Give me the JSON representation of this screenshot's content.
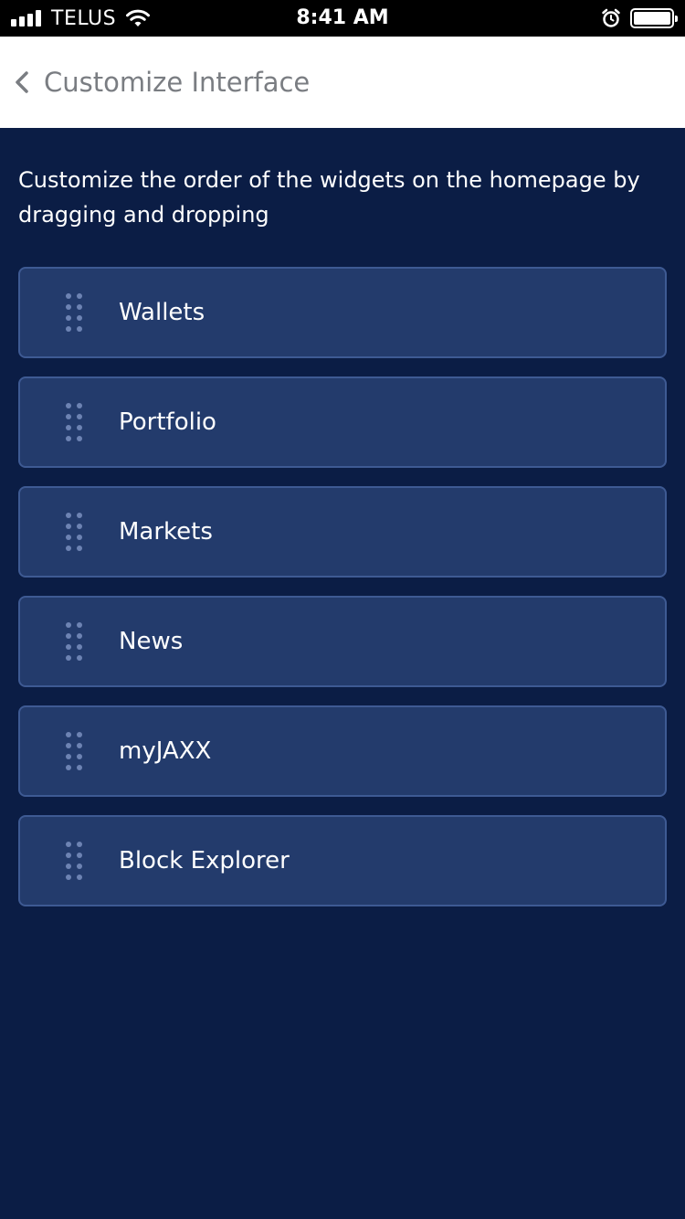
{
  "status_bar": {
    "carrier": "TELUS",
    "time": "8:41 AM",
    "signal_bars": 4,
    "signal_icon": "signal-icon",
    "wifi_icon": "wifi-icon",
    "alarm_icon": "alarm-icon",
    "battery_icon": "battery-icon",
    "battery_level": 1.0
  },
  "nav": {
    "back_icon": "chevron-left-icon",
    "title": "Customize Interface"
  },
  "main": {
    "instruction": "Customize the order of the widgets on the homepage by dragging and dropping",
    "drag_handle_icon": "drag-handle-icon",
    "widgets": [
      {
        "label": "Wallets"
      },
      {
        "label": "Portfolio"
      },
      {
        "label": "Markets"
      },
      {
        "label": "News"
      },
      {
        "label": "myJAXX"
      },
      {
        "label": "Block Explorer"
      }
    ]
  },
  "colors": {
    "background": "#0b1d45",
    "card": "#233b6c",
    "card_border": "#3e5a93",
    "nav_background": "#ffffff",
    "nav_title": "#7a7d82"
  }
}
